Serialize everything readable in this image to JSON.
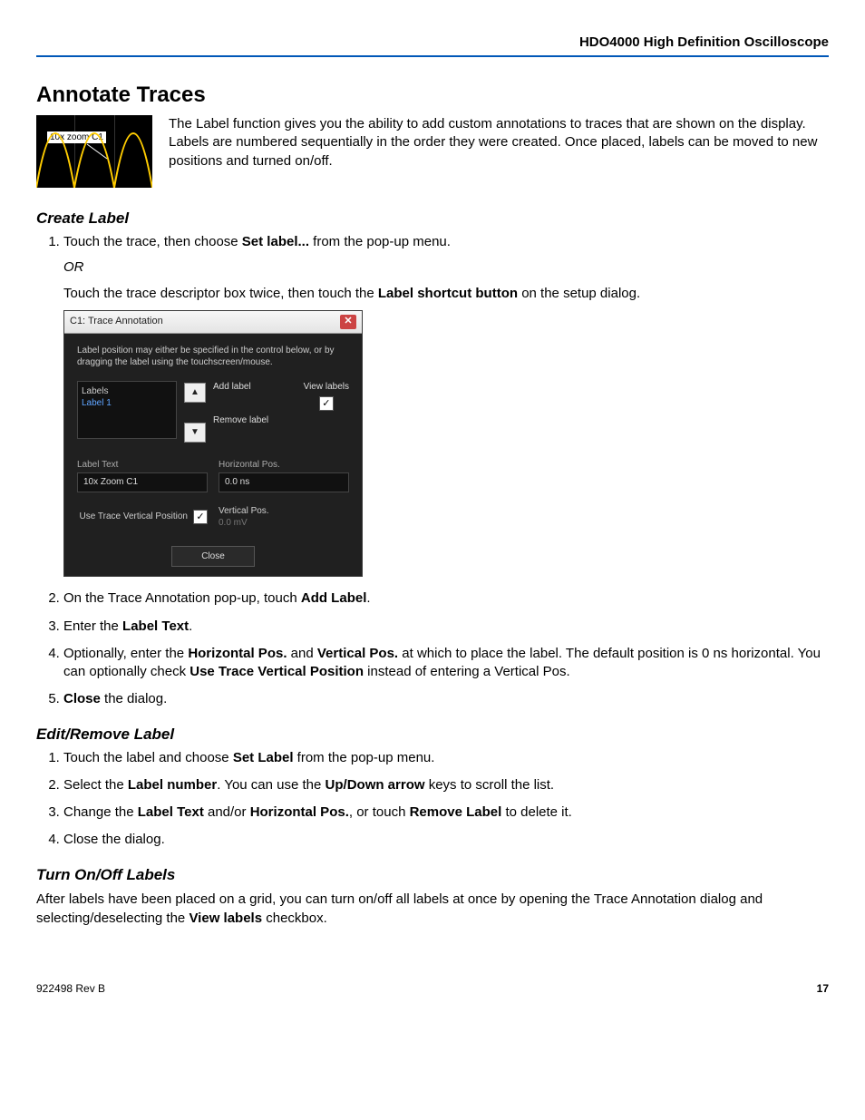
{
  "header": {
    "product": "HDO4000 High Definition Oscilloscope"
  },
  "title": "Annotate Traces",
  "thumb_label": "10x zoom C1",
  "intro": "The Label function gives you the ability to add custom annotations to traces that are shown on the display. Labels are numbered sequentially in the order they were created. Once placed, labels can be moved to new positions and turned on/off.",
  "sections": {
    "create": {
      "heading": "Create Label",
      "step1_a": "Touch the trace, then choose ",
      "step1_b": "Set label...",
      "step1_c": " from the pop-up menu.",
      "or": "OR",
      "step1_d": "Touch the trace descriptor box twice, then touch the ",
      "step1_e": "Label shortcut button",
      "step1_f": " on the setup dialog.",
      "step2_a": "On the Trace Annotation pop-up, touch ",
      "step2_b": "Add Label",
      "step2_c": ".",
      "step3_a": "Enter the ",
      "step3_b": "Label Text",
      "step3_c": ".",
      "step4_a": "Optionally, enter the ",
      "step4_b": "Horizontal Pos.",
      "step4_c": " and ",
      "step4_d": "Vertical Pos.",
      "step4_e": " at which to place the label. The default position is 0 ns horizontal. You can optionally check ",
      "step4_f": "Use Trace Vertical Position",
      "step4_g": " instead of entering a Vertical Pos.",
      "step5_a": "Close",
      "step5_b": " the dialog."
    },
    "edit": {
      "heading": "Edit/Remove Label",
      "step1_a": "Touch the label and choose ",
      "step1_b": "Set Label",
      "step1_c": " from the pop-up menu.",
      "step2_a": "Select the ",
      "step2_b": "Label number",
      "step2_c": ". You can use the ",
      "step2_d": "Up/Down arrow",
      "step2_e": " keys to scroll the list.",
      "step3_a": "Change the ",
      "step3_b": "Label Text",
      "step3_c": " and/or ",
      "step3_d": "Horizontal Pos.",
      "step3_e": ", or touch ",
      "step3_f": "Remove Label",
      "step3_g": " to delete it.",
      "step4": "Close the dialog."
    },
    "toggle": {
      "heading": "Turn On/Off Labels",
      "body_a": "After labels have been placed on a grid, you can turn on/off all labels at once by opening the Trace Annotation dialog and selecting/deselecting the ",
      "body_b": "View labels",
      "body_c": " checkbox."
    }
  },
  "dialog": {
    "title": "C1: Trace Annotation",
    "hint": "Label position may either be specified in the control below, or by dragging the label using the touchscreen/mouse.",
    "labels_caption": "Labels",
    "labels_item1": "Label 1",
    "add_label": "Add label",
    "remove_label": "Remove label",
    "view_labels": "View labels",
    "label_text_caption": "Label Text",
    "label_text_value": "10x Zoom C1",
    "hpos_caption": "Horizontal Pos.",
    "hpos_value": "0.0 ns",
    "use_trace_vpos": "Use Trace Vertical Position",
    "vpos_caption": "Vertical Pos.",
    "vpos_value": "0.0 mV",
    "close": "Close"
  },
  "footer": {
    "doc_rev": "922498 Rev B",
    "page": "17"
  }
}
